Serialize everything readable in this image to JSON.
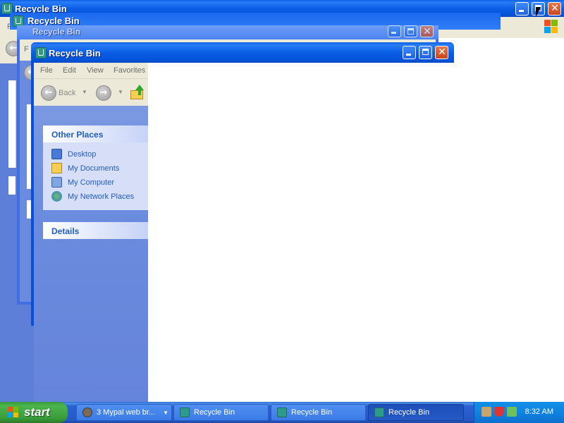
{
  "windows": {
    "back_title": "Recycle Bin",
    "mid_title": "Recycle Bin",
    "far_title": "Recycle Bin",
    "front_title": "Recycle Bin"
  },
  "menu": {
    "file": "File",
    "edit": "Edit",
    "view": "View",
    "favorites": "Favorites",
    "back_menu_initial": "F"
  },
  "toolbar": {
    "back_label": "Back"
  },
  "sidebar": {
    "other_places": {
      "header": "Other Places",
      "items": [
        {
          "label": "Desktop",
          "icon": "desktop-icon"
        },
        {
          "label": "My Documents",
          "icon": "my-documents-icon"
        },
        {
          "label": "My Computer",
          "icon": "my-computer-icon"
        },
        {
          "label": "My Network Places",
          "icon": "my-network-places-icon"
        }
      ]
    },
    "details": {
      "header": "Details"
    }
  },
  "taskbar": {
    "start_label": "start",
    "items": [
      {
        "label": "3 Mypal web br...",
        "active": false
      },
      {
        "label": "Recycle Bin",
        "active": false
      },
      {
        "label": "Recycle Bin",
        "active": false
      },
      {
        "label": "Recycle Bin",
        "active": true
      }
    ],
    "clock": "8:32 AM"
  },
  "colors": {
    "titlebar_blue": "#0a5ee0",
    "panel_blue": "#6a8bde",
    "link_blue": "#215dc6",
    "start_green": "#3c9a3c",
    "tray_blue": "#0f83e0"
  }
}
